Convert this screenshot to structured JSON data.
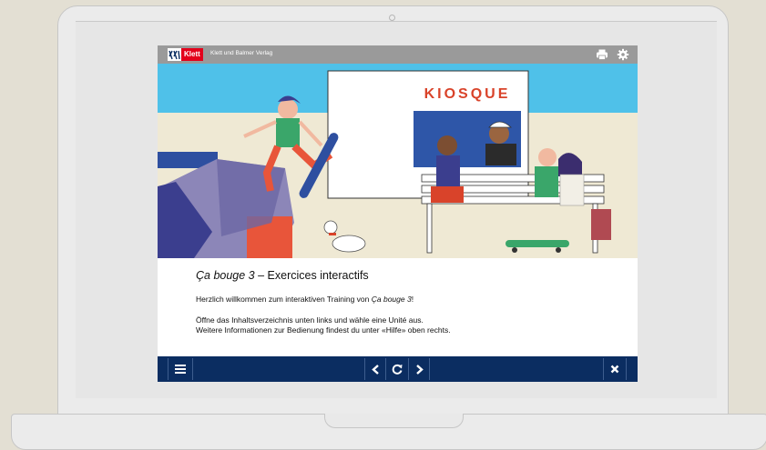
{
  "app": {
    "brand": "Klett",
    "publisher": "Klett und Balmer Verlag"
  },
  "illustration": {
    "sign": "KIOSQUE"
  },
  "intro": {
    "title_italic": "Ça bouge 3",
    "title_rest": " – Exercices interactifs",
    "welcome_pre": "Herzlich willkommen zum interaktiven Training von ",
    "welcome_italic": "Ça bouge 3",
    "welcome_post": "!",
    "hint_1": "Öffne das Inhaltsverzeichnis unten links und wähle eine Unité aus.",
    "hint_2": "Weitere Informationen zur Bedienung findest du unter «Hilfe» oben rechts."
  },
  "icons": {
    "print": "print-icon",
    "settings": "gear-icon",
    "menu": "menu-icon",
    "prev": "chevron-left-icon",
    "reload": "reload-icon",
    "next": "chevron-right-icon",
    "close": "close-icon"
  },
  "colors": {
    "topbar": "#9a9a9a",
    "bottombar": "#0b2d61",
    "sky": "#4fc1e9",
    "klett_red": "#e3001b"
  }
}
